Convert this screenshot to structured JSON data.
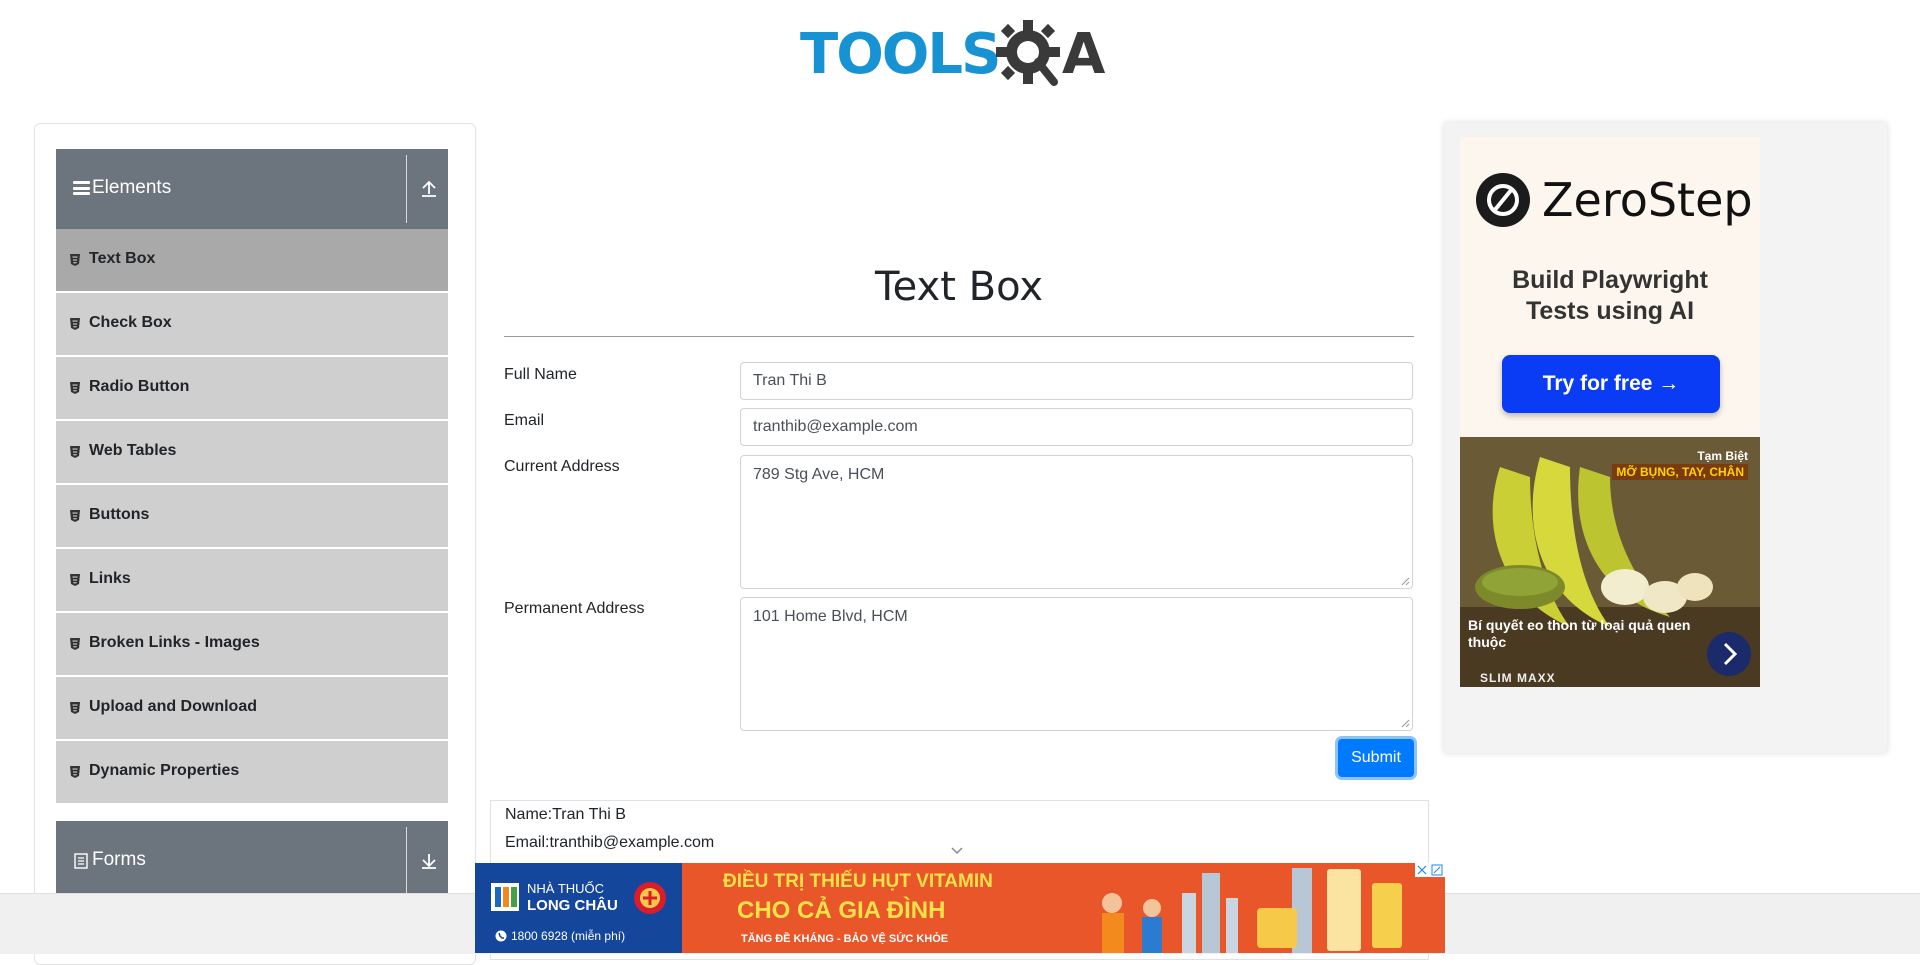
{
  "header": {
    "logo_tools": "TOOLS",
    "logo_qa": "QA"
  },
  "sidebar": {
    "elements_group": {
      "label": "Elements",
      "icon": "upload-arrow-icon"
    },
    "items": [
      {
        "label": "Text Box",
        "active": true
      },
      {
        "label": "Check Box"
      },
      {
        "label": "Radio Button"
      },
      {
        "label": "Web Tables"
      },
      {
        "label": "Buttons"
      },
      {
        "label": "Links"
      },
      {
        "label": "Broken Links - Images"
      },
      {
        "label": "Upload and Download"
      },
      {
        "label": "Dynamic Properties"
      }
    ],
    "forms_group": {
      "label": "Forms",
      "icon": "download-arrow-icon"
    }
  },
  "main": {
    "title": "Text Box",
    "full_name_label": "Full Name",
    "full_name_value": "Tran Thi B",
    "email_label": "Email",
    "email_value": "tranthib@example.com",
    "current_address_label": "Current Address",
    "current_address_value": "789 Stg Ave, HCM",
    "permanent_address_label": "Permanent Address",
    "permanent_address_value": "101 Home Blvd, HCM",
    "submit_label": "Submit",
    "output_name": "Name:Tran Thi B",
    "output_email": "Email:tranthib@example.com"
  },
  "ad_right": {
    "brand": "ZeroStep",
    "tagline_line1": "Build Playwright",
    "tagline_line2": "Tests using AI",
    "cta": "Try for free →",
    "banana_badge_top": "Tạm Biệt",
    "banana_badge_bottom": "MỠ BỤNG, TAY, CHÂN",
    "banana_caption": "Bí quyết eo thon từ loại quả quen thuộc",
    "banana_brand": "SLIM MAXX"
  },
  "ad_bottom": {
    "pharmacy_line1": "NHÀ THUỐC",
    "pharmacy_line2": "LONG CHÂU",
    "phone": "1800 6928 (miễn phí)",
    "headline1": "ĐIỀU TRỊ THIẾU HỤT VITAMIN",
    "headline2": "CHO CẢ GIA ĐÌNH",
    "sub": "TĂNG ĐỀ KHÁNG - BẢO VỆ SỨC KHỎE"
  },
  "colors": {
    "accent": "#007bff",
    "sidebar_header": "#6c757d",
    "sidebar_item": "#cfcfcf",
    "sidebar_item_active": "#a9a9a9",
    "logo_blue": "#1793d3"
  }
}
